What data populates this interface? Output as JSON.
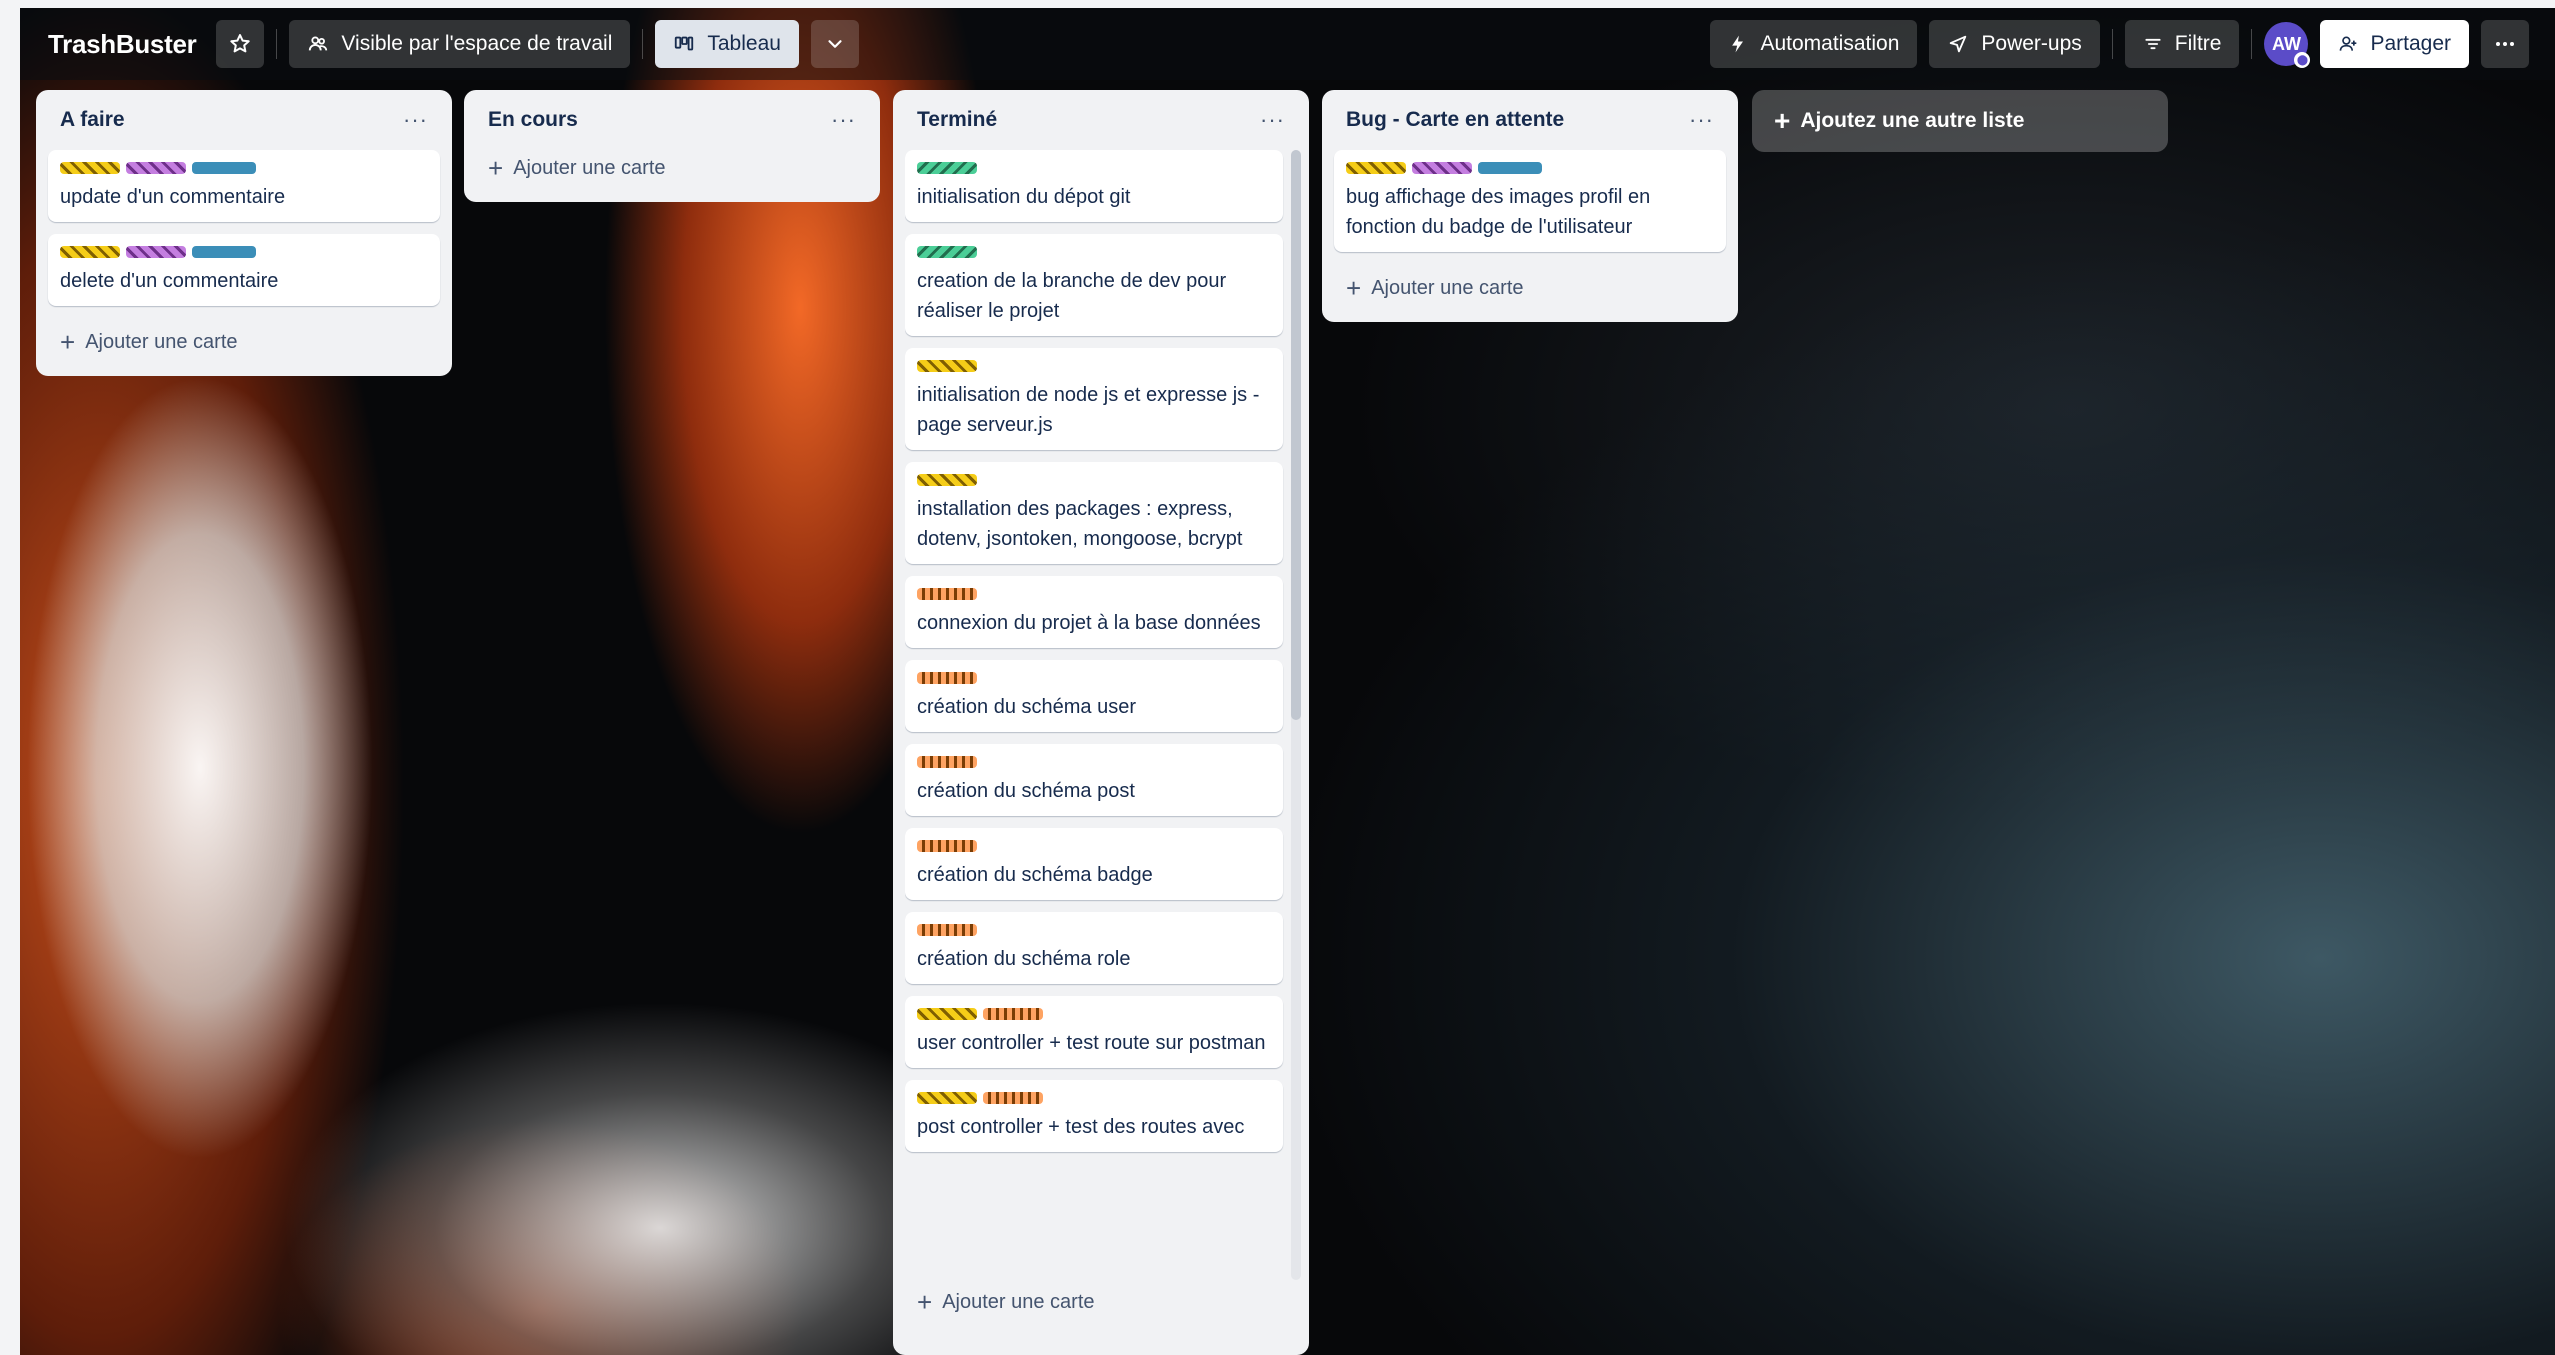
{
  "header": {
    "title": "TrashBuster",
    "visibility_label": "Visible par l'espace de travail",
    "view_label": "Tableau",
    "automation_label": "Automatisation",
    "powerups_label": "Power-ups",
    "filter_label": "Filtre",
    "avatar_initials": "AW",
    "share_label": "Partager"
  },
  "lists": [
    {
      "title": "A faire",
      "cards": [
        {
          "labels": [
            "yellow",
            "purple",
            "blue"
          ],
          "text": "update d'un commentaire"
        },
        {
          "labels": [
            "yellow",
            "purple",
            "blue"
          ],
          "text": "delete d'un commentaire"
        }
      ],
      "add_label": "Ajouter une carte"
    },
    {
      "title": "En cours",
      "cards": [],
      "add_label": "Ajouter une carte"
    },
    {
      "title": "Terminé",
      "cards": [
        {
          "labels": [
            "green"
          ],
          "text": "initialisation du dépot git"
        },
        {
          "labels": [
            "green"
          ],
          "text": "creation de la branche de dev pour réaliser le projet"
        },
        {
          "labels": [
            "yellow"
          ],
          "text": "initialisation de node js et expresse js - page serveur.js"
        },
        {
          "labels": [
            "yellow"
          ],
          "text": "installation des packages : express, dotenv, jsontoken, mongoose, bcrypt"
        },
        {
          "labels": [
            "orange"
          ],
          "text": "connexion du projet à la base données"
        },
        {
          "labels": [
            "orange"
          ],
          "text": "création du schéma user"
        },
        {
          "labels": [
            "orange"
          ],
          "text": "création du schéma post"
        },
        {
          "labels": [
            "orange"
          ],
          "text": "création du schéma badge"
        },
        {
          "labels": [
            "orange"
          ],
          "text": "création du schéma role"
        },
        {
          "labels": [
            "yellow",
            "orange"
          ],
          "text": "user controller + test route sur postman"
        },
        {
          "labels": [
            "yellow",
            "orange"
          ],
          "text": "post controller + test des routes avec"
        }
      ],
      "add_label": "Ajouter une carte"
    },
    {
      "title": "Bug - Carte en attente",
      "cards": [
        {
          "labels": [
            "yellow",
            "purple",
            "blue"
          ],
          "text": "bug affichage des images profil en fonction du badge de l'utilisateur"
        }
      ],
      "add_label": "Ajouter une carte"
    }
  ],
  "add_list_label": "Ajoutez une autre liste",
  "colors": {
    "yellow": "#f5cd18",
    "purple": "#c47ee0",
    "blue": "#3b8eb8",
    "green": "#4bce97",
    "orange": "#fea362",
    "list_bg": "#f1f2f4",
    "text": "#172b4d"
  }
}
